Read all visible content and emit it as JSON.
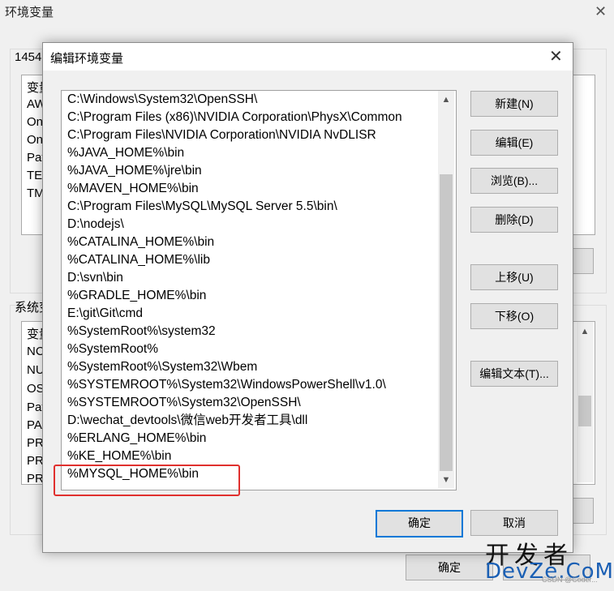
{
  "parent": {
    "title": "环境变量",
    "user_group_label": "1454",
    "user_list": {
      "header": "变量",
      "rows": [
        "AW",
        "On",
        "On",
        "Pat",
        "TEI",
        "TM"
      ]
    },
    "system_group_label": "系统变",
    "system_list": {
      "header": "变量",
      "rows": [
        "NC",
        "NU",
        "OS",
        "Pat",
        "PA",
        "PR",
        "PR",
        "PR"
      ]
    },
    "ok_label": "确定"
  },
  "dialog": {
    "title": "编辑环境变量",
    "paths": [
      "C:\\Windows\\System32\\OpenSSH\\",
      "C:\\Program Files (x86)\\NVIDIA Corporation\\PhysX\\Common",
      "C:\\Program Files\\NVIDIA Corporation\\NVIDIA NvDLISR",
      "%JAVA_HOME%\\bin",
      "%JAVA_HOME%\\jre\\bin",
      "%MAVEN_HOME%\\bin",
      "C:\\Program Files\\MySQL\\MySQL Server 5.5\\bin\\",
      "D:\\nodejs\\",
      "%CATALINA_HOME%\\bin",
      "%CATALINA_HOME%\\lib",
      "D:\\svn\\bin",
      "%GRADLE_HOME%\\bin",
      "E:\\git\\Git\\cmd",
      "%SystemRoot%\\system32",
      "%SystemRoot%",
      "%SystemRoot%\\System32\\Wbem",
      "%SYSTEMROOT%\\System32\\WindowsPowerShell\\v1.0\\",
      "%SYSTEMROOT%\\System32\\OpenSSH\\",
      "D:\\wechat_devtools\\微信web开发者工具\\dll",
      "%ERLANG_HOME%\\bin",
      "%KE_HOME%\\bin",
      "%MYSQL_HOME%\\bin"
    ],
    "buttons": {
      "new": "新建(N)",
      "edit": "编辑(E)",
      "browse": "浏览(B)...",
      "delete": "删除(D)",
      "move_up": "上移(U)",
      "move_down": "下移(O)",
      "edit_text": "编辑文本(T)...",
      "ok": "确定",
      "cancel": "取消"
    }
  },
  "watermark": {
    "cn": "开发者",
    "en": "DevZe.CoM",
    "small": "CSDN @Coder..."
  },
  "colors": {
    "highlight": "#e0302e",
    "default_button_border": "#0078d7"
  }
}
